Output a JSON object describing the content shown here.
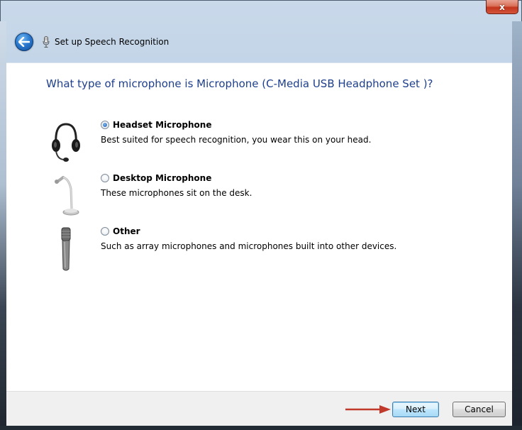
{
  "window": {
    "close_glyph": "x"
  },
  "nav": {
    "title": "Set up Speech Recognition",
    "back_icon": "back-arrow-icon",
    "app_icon": "microphone-icon"
  },
  "question": "What type of microphone is Microphone (C-Media USB Headphone Set )?",
  "options": [
    {
      "label": "Headset Microphone",
      "description": "Best suited for speech recognition, you wear this on your head.",
      "selected": true,
      "icon": "headset-icon"
    },
    {
      "label": "Desktop Microphone",
      "description": "These microphones sit on the desk.",
      "selected": false,
      "icon": "desktop-microphone-icon"
    },
    {
      "label": "Other",
      "description": "Such as array microphones and microphones built into other devices.",
      "selected": false,
      "icon": "handheld-microphone-icon"
    }
  ],
  "buttons": {
    "next": "Next",
    "cancel": "Cancel"
  },
  "colors": {
    "question_text": "#1e3f8c",
    "annotation_arrow": "#c0392b"
  }
}
